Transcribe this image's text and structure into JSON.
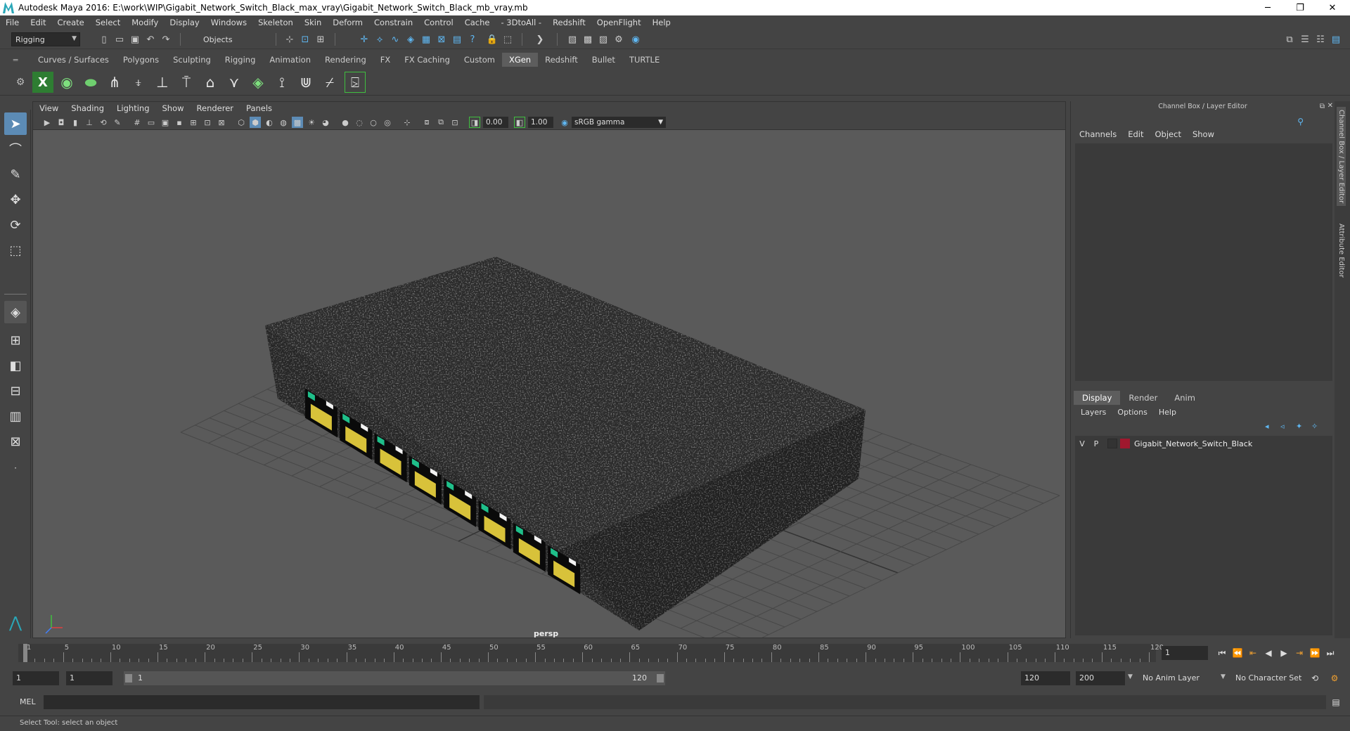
{
  "window": {
    "title": "Autodesk Maya 2016: E:\\work\\WIP\\Gigabit_Network_Switch_Black_max_vray\\Gigabit_Network_Switch_Black_mb_vray.mb",
    "minimize": "─",
    "restore": "❐",
    "close": "✕"
  },
  "menu": [
    "File",
    "Edit",
    "Create",
    "Select",
    "Modify",
    "Display",
    "Windows",
    "Skeleton",
    "Skin",
    "Deform",
    "Constrain",
    "Control",
    "Cache",
    "- 3DtoAll -",
    "Redshift",
    "OpenFlight",
    "Help"
  ],
  "statusline": {
    "mode": "Rigging",
    "selection_mode": "Objects"
  },
  "shelf_tabs": [
    "Curves / Surfaces",
    "Polygons",
    "Sculpting",
    "Rigging",
    "Animation",
    "Rendering",
    "FX",
    "FX Caching",
    "Custom",
    "XGen",
    "Redshift",
    "Bullet",
    "TURTLE"
  ],
  "active_shelf": "XGen",
  "viewport": {
    "menu": [
      "View",
      "Shading",
      "Lighting",
      "Show",
      "Renderer",
      "Panels"
    ],
    "exposure": "0.00",
    "gamma": "1.00",
    "color_space": "sRGB gamma",
    "camera": "persp"
  },
  "channel_box": {
    "title": "Channel Box / Layer Editor",
    "menu": [
      "Channels",
      "Edit",
      "Object",
      "Show"
    ]
  },
  "layer_editor": {
    "tabs": [
      "Display",
      "Render",
      "Anim"
    ],
    "active_tab": "Display",
    "menu": [
      "Layers",
      "Options",
      "Help"
    ],
    "layers": [
      {
        "v": "V",
        "p": "P",
        "color": "#a0182e",
        "name": "Gigabit_Network_Switch_Black"
      }
    ]
  },
  "side_tabs": [
    "Channel Box / Layer Editor",
    "Attribute Editor"
  ],
  "timeline": {
    "labels": [
      "1",
      "5",
      "10",
      "15",
      "20",
      "25",
      "30",
      "35",
      "40",
      "45",
      "50",
      "55",
      "60",
      "65",
      "70",
      "75",
      "80",
      "85",
      "90",
      "95",
      "100",
      "105",
      "110",
      "115",
      "120"
    ],
    "current_frame": "1"
  },
  "range": {
    "start": "1",
    "playback_start": "1",
    "slider_start": "1",
    "slider_end": "120",
    "playback_end": "120",
    "end": "200",
    "anim_layer": "No Anim Layer",
    "character_set": "No Character Set"
  },
  "command_line": {
    "label": "MEL"
  },
  "help_line": "Select Tool: select an object"
}
